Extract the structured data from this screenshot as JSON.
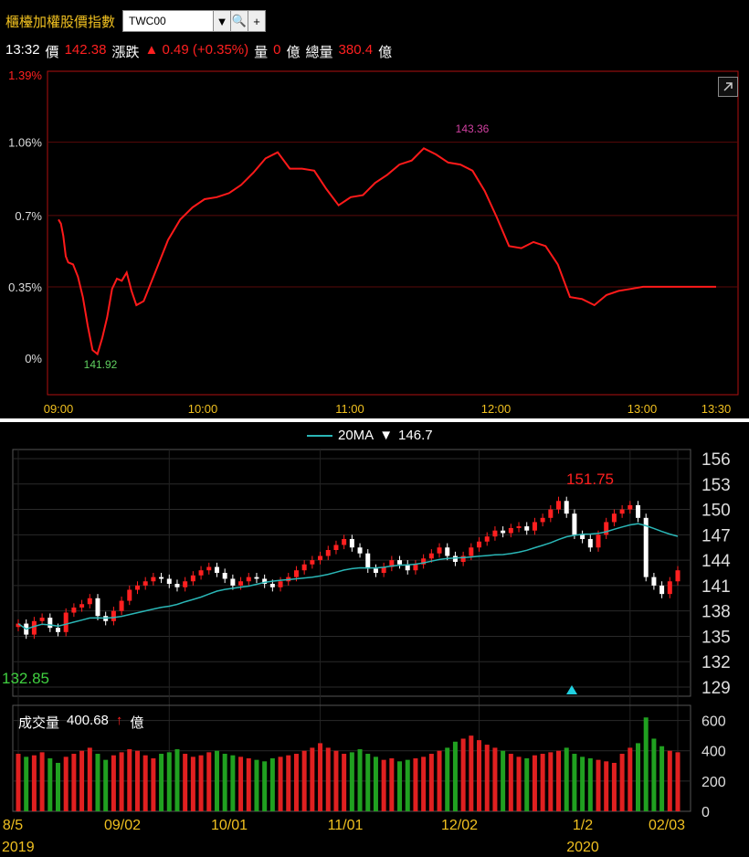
{
  "header": {
    "title": "櫃檯加權股價指數",
    "symbol": "TWC00",
    "time": "13:32",
    "price_label": "價",
    "price": "142.38",
    "change_label": "漲跌",
    "change": "▲ 0.49 (+0.35%)",
    "volume_label": "量",
    "volume": "0",
    "volume_unit": "億",
    "total_label": "總量",
    "total": "380.4",
    "total_unit": "億"
  },
  "legend": {
    "name": "20MA",
    "arrow": "▼",
    "value": "146.7"
  },
  "volume_panel": {
    "label": "成交量",
    "value": "400.68",
    "arrow": "↑",
    "unit": "億"
  },
  "colors": {
    "up": "#ff2020",
    "down": "#ffffff",
    "ma": "#2ab6b6",
    "vol_up": "#e02020",
    "vol_down": "#20a020"
  },
  "chart_data": [
    {
      "type": "line",
      "x_ticks": [
        "09:00",
        "10:00",
        "11:00",
        "12:00",
        "13:00",
        "13:30"
      ],
      "y_ticks": [
        "0%",
        "0.35%",
        "0.7%",
        "1.06%",
        "1.39%"
      ],
      "ylim": [
        0,
        1.39
      ],
      "annotations": {
        "high": "143.36",
        "low": "141.92"
      },
      "series": [
        {
          "x": [
            0,
            1,
            2,
            3,
            4,
            6,
            8,
            10,
            12,
            14,
            16,
            18,
            20,
            22,
            24,
            26,
            28,
            30,
            32,
            35,
            40,
            45,
            50,
            55,
            60,
            65,
            70,
            75,
            80,
            85,
            90,
            95,
            100,
            105,
            110,
            115,
            120,
            125,
            130,
            135,
            140,
            145,
            150,
            155,
            160,
            165,
            170,
            175,
            180,
            185,
            190,
            195,
            200,
            205,
            210,
            215,
            220,
            225,
            230,
            235,
            240,
            245,
            250,
            255,
            260,
            265,
            270
          ],
          "y": [
            0.68,
            0.66,
            0.6,
            0.5,
            0.47,
            0.46,
            0.4,
            0.3,
            0.16,
            0.04,
            0.02,
            0.1,
            0.2,
            0.34,
            0.39,
            0.38,
            0.42,
            0.33,
            0.26,
            0.28,
            0.43,
            0.58,
            0.68,
            0.74,
            0.78,
            0.79,
            0.81,
            0.85,
            0.91,
            0.98,
            1.01,
            0.93,
            0.93,
            0.92,
            0.83,
            0.75,
            0.79,
            0.8,
            0.86,
            0.9,
            0.95,
            0.97,
            1.03,
            1.0,
            0.96,
            0.95,
            0.92,
            0.82,
            0.69,
            0.55,
            0.54,
            0.57,
            0.55,
            0.46,
            0.3,
            0.29,
            0.26,
            0.31,
            0.33,
            0.34,
            0.35,
            0.35,
            0.35,
            0.35,
            0.35,
            0.35,
            0.35
          ]
        }
      ]
    },
    {
      "type": "candlestick",
      "x_ticks": [
        "8/5",
        "09/02",
        "10/01",
        "11/01",
        "12/02",
        "1/2",
        "02/03"
      ],
      "x_year_labels": [
        "2019",
        "2020"
      ],
      "y_ticks": [
        "129",
        "132",
        "135",
        "138",
        "141",
        "144",
        "147",
        "150",
        "153",
        "156"
      ],
      "ylim": [
        129,
        156
      ],
      "annotations": {
        "high": "151.75",
        "low": "132.85"
      },
      "closes": [
        136.5,
        135.2,
        136.8,
        137.2,
        136.0,
        135.5,
        137.8,
        138.4,
        138.8,
        139.5,
        137.4,
        136.8,
        138.0,
        139.2,
        140.5,
        141.0,
        141.5,
        142.0,
        141.8,
        141.2,
        140.8,
        141.5,
        142.2,
        142.8,
        143.2,
        142.5,
        141.8,
        141.0,
        141.5,
        142.0,
        141.8,
        141.2,
        140.8,
        141.5,
        142.0,
        142.8,
        143.5,
        144.0,
        144.5,
        145.2,
        145.8,
        146.5,
        145.5,
        144.8,
        143.0,
        142.5,
        143.2,
        144.0,
        143.5,
        142.8,
        143.5,
        144.2,
        144.8,
        145.5,
        144.5,
        143.8,
        144.5,
        145.5,
        146.2,
        146.8,
        147.5,
        147.2,
        147.8,
        148.0,
        147.5,
        148.5,
        149.0,
        150.0,
        151.0,
        149.5,
        147.0,
        146.5,
        145.5,
        147.0,
        148.5,
        149.5,
        150.0,
        150.5,
        149.0,
        142.0,
        141.0,
        140.0,
        141.5,
        142.8
      ],
      "ma20_label": "20MA",
      "volume_ylim": [
        0,
        700
      ],
      "volume_ticks": [
        "0",
        "200",
        "400",
        "600"
      ],
      "volumes": [
        380,
        360,
        370,
        390,
        350,
        320,
        360,
        380,
        400,
        420,
        380,
        340,
        370,
        390,
        410,
        400,
        370,
        350,
        380,
        390,
        410,
        380,
        360,
        370,
        390,
        400,
        380,
        370,
        360,
        350,
        340,
        330,
        350,
        360,
        370,
        380,
        400,
        420,
        450,
        420,
        400,
        380,
        390,
        410,
        380,
        360,
        340,
        350,
        330,
        340,
        350,
        360,
        380,
        400,
        420,
        460,
        480,
        500,
        470,
        440,
        420,
        400,
        380,
        360,
        350,
        370,
        380,
        390,
        400,
        420,
        380,
        360,
        350,
        340,
        330,
        320,
        380,
        420,
        450,
        620,
        480,
        430,
        400,
        390
      ]
    }
  ]
}
